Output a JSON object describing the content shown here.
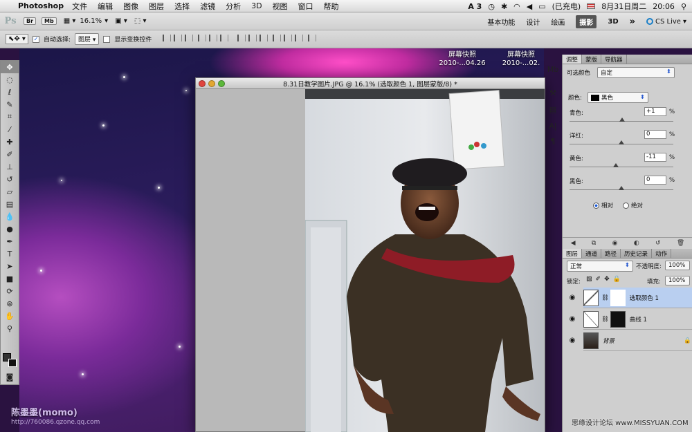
{
  "menubar": {
    "app_name": "Photoshop",
    "items": [
      "文件",
      "编辑",
      "图像",
      "图层",
      "选择",
      "滤镜",
      "分析",
      "3D",
      "视图",
      "窗口",
      "帮助"
    ],
    "status_battery": "(已充电)",
    "date": "8月31日周二",
    "time": "20:06"
  },
  "appbar": {
    "logo": "Ps",
    "br": "Br",
    "mb": "Mb",
    "zoom": "16.1%",
    "workspaces": [
      "基本功能",
      "设计",
      "绘画",
      "摄影",
      "3D"
    ],
    "active_workspace": "摄影",
    "more": "»",
    "cs_live": "CS Live"
  },
  "optbar": {
    "auto_select_label": "自动选择:",
    "auto_select_value": "图层",
    "show_transform_label": "显示变换控件"
  },
  "desktop": {
    "icon1_title": "屏幕快照",
    "icon1_date": "2010-...04.26",
    "icon2_title": "屏幕快照",
    "icon2_date": "2010-...02.",
    "watermark": "陈墨墨(momo)",
    "watermark_url": "http://760086.qzone.qq.com"
  },
  "document": {
    "title": "8.31日教学图片.JPG @ 16.1% (选取颜色 1, 图层蒙版/8) *"
  },
  "adjust_panel": {
    "tabs": [
      "调整",
      "蒙版",
      "导航器"
    ],
    "active_tab": "调整",
    "type_label": "可选颜色",
    "preset_value": "自定",
    "color_label": "颜色:",
    "color_value": "黑色",
    "sliders": [
      {
        "label": "青色:",
        "value": "+1",
        "pct": "%",
        "position": 0.505
      },
      {
        "label": "洋红:",
        "value": "0",
        "pct": "%",
        "position": 0.5
      },
      {
        "label": "黄色:",
        "value": "-11",
        "pct": "%",
        "position": 0.445
      },
      {
        "label": "黑色:",
        "value": "0",
        "pct": "%",
        "position": 0.5
      }
    ],
    "method_relative": "相对",
    "method_absolute": "绝对",
    "method_selected": "相对"
  },
  "layers_panel": {
    "tabs": [
      "图层",
      "通道",
      "路径",
      "历史记录",
      "动作"
    ],
    "active_tab": "图层",
    "blend_mode": "正常",
    "opacity_label": "不透明度:",
    "opacity_value": "100%",
    "lock_label": "锁定:",
    "fill_label": "填充:",
    "fill_value": "100%",
    "layers": [
      {
        "name": "选取颜色 1",
        "selected": true
      },
      {
        "name": "曲线 1",
        "selected": false
      },
      {
        "name": "背景",
        "selected": false
      }
    ]
  },
  "bottom_watermark": "思缘设计论坛 www.MISSYUAN.COM",
  "colors": {
    "selected_layer": "#b9cff0",
    "desktop_accent": "#c02ca0",
    "active_workspace_bg": "#555555"
  }
}
